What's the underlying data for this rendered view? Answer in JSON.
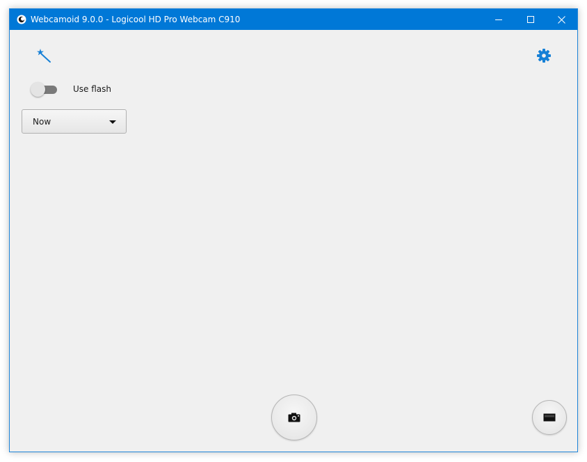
{
  "window": {
    "title": "Webcamoid 9.0.0 - Logicool HD Pro Webcam C910",
    "app_icon": "webcamoid-logo-icon",
    "controls": [
      "minimize-icon",
      "maximize-icon",
      "close-icon"
    ]
  },
  "toolbar": {
    "left_icon": "magic-wand-icon",
    "right_icon": "gear-icon"
  },
  "flash": {
    "label": "Use flash",
    "enabled": false
  },
  "timer": {
    "selected": "Now"
  },
  "bottom": {
    "capture_icon": "camera-icon",
    "record_icon": "video-record-icon"
  },
  "colors": {
    "titlebar": "#0078d7",
    "accent": "#1680d6",
    "background": "#f0f0f0"
  }
}
